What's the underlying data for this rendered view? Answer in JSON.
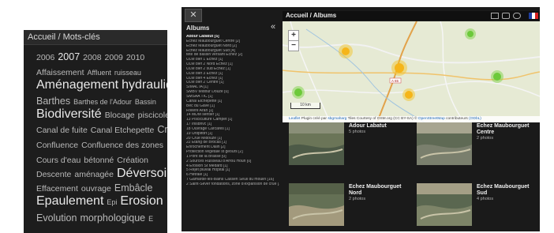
{
  "tags_panel": {
    "breadcrumb": "Accueil / Mots-clés",
    "lines": [
      [
        {
          "t": "2006",
          "s": 2
        },
        {
          "t": "2007",
          "s": 3,
          "b": true
        },
        {
          "t": "2008",
          "s": 2
        },
        {
          "t": "2009",
          "s": 2
        },
        {
          "t": "2010",
          "s": 2
        }
      ],
      [
        {
          "t": "Affaissement",
          "s": 2
        },
        {
          "t": "Affluent",
          "s": 1
        },
        {
          "t": "ruisseau",
          "s": 1
        }
      ],
      [
        {
          "t": "Aménagement",
          "s": 4,
          "b": true
        },
        {
          "t": "hydraulique",
          "s": 4,
          "b": true
        }
      ],
      [
        {
          "t": "Barthes",
          "s": 3
        },
        {
          "t": "Barthes de l'Adour",
          "s": 1
        },
        {
          "t": "Bassin",
          "s": 1
        }
      ],
      [
        {
          "t": "Biodiversité",
          "s": 4,
          "b": true
        },
        {
          "t": "Blocage",
          "s": 2
        },
        {
          "t": "piscicole",
          "s": 2
        }
      ],
      [
        {
          "t": "Canal de fuite",
          "s": 2
        },
        {
          "t": "Canal Etchepette",
          "s": 2
        },
        {
          "t": "Crue",
          "s": 3
        }
      ],
      [
        {
          "t": "Confluence",
          "s": 2
        },
        {
          "t": "Confluence des zones",
          "s": 2
        }
      ],
      [
        {
          "t": "Cours d'eau",
          "s": 2
        },
        {
          "t": "bétonné",
          "s": 2
        },
        {
          "t": "Création",
          "s": 2
        }
      ],
      [
        {
          "t": "Descente",
          "s": 2
        },
        {
          "t": "aménagée",
          "s": 2
        },
        {
          "t": "Déversoir",
          "s": 4,
          "b": true
        }
      ],
      [
        {
          "t": "Effacement",
          "s": 2
        },
        {
          "t": "ouvrage",
          "s": 2
        },
        {
          "t": "Embâcle",
          "s": 3
        }
      ],
      [
        {
          "t": "Epaulement",
          "s": 4,
          "b": true
        },
        {
          "t": "Epi",
          "s": 1
        },
        {
          "t": "Erosion",
          "s": 4,
          "b": true
        }
      ],
      [
        {
          "t": "Evolution",
          "s": 3
        },
        {
          "t": "morphologique",
          "s": 3
        },
        {
          "t": "E",
          "s": 1
        }
      ]
    ]
  },
  "app": {
    "breadcrumb": "Accueil / Albums",
    "sidebar_title": "Albums",
    "albums": [
      "Adour Labatut [5]",
      "Echez Maubourguet Centre [2]",
      "Echez Maubourguet Nord [2]",
      "Echez Maubourguet Sud [4]",
      "tete de bassin versant Echez [2]",
      "ULM bief 1 Echez [1]",
      "ULM bief 2 Nord Echez [1]",
      "ULM bief 2 sud Echez [1]",
      "ULM bief 3 Echez [1]",
      "ULM bief 4 Echez [1]",
      "ULM bief 2 Centre [1]",
      "SIMAL IA [1]",
      "SMBV Midour Douze [0]",
      "SMSAA TIC [1]",
      "Canal Etchepette [1]",
      "Bec du Gave [1]",
      "Riviere Aran [1]",
      "14 MDM sentier [1]",
      "13 Pisciculture Campet [1]",
      "17 Inisbrivc [1]",
      "18 Ouvrage Carcares [1]",
      "19 Urdplfdrt [1]",
      "20 Crue Midouze [1]",
      "22 Etang de Brocas [1]",
      "Enrochement Dalin [2]",
      "Protection vegetale st geours [2]",
      "1 Pont de la Brasse [0]",
      "2 Sources Ruisseau d'Arrou Houn [0]",
      "4 Erosion St Medard [1]",
      "5 Rejet pluvial Hopital [1]",
      "6 Hetrale [1]",
      "7 Gamarde-les-Bains Cassen Seuil du moulin [16]",
      "2 Saint-Sever fondations, zone d'expansion de crue [1]"
    ],
    "map": {
      "zoom_in": "+",
      "zoom_out": "−",
      "scale_label": "10 km",
      "road_label": "A 65",
      "attribution_parts": [
        "Leaflet",
        " Plugin créé par ",
        "sbgmaharg",
        " Tiles Courtesy of OSM.org (CC BY-SA) © ",
        "OpenStreetMap",
        " contributeurs ",
        "(ODbL)"
      ]
    },
    "tiles": [
      {
        "name": "Adour Labatut",
        "count": "5 photos"
      },
      {
        "name": "Echez Maubourguet Centre",
        "count": "2 photos"
      },
      {
        "name": "Echez Maubourguet Nord",
        "count": "2 photos"
      },
      {
        "name": "Echez Maubourguet Sud",
        "count": "4 photos"
      }
    ]
  }
}
